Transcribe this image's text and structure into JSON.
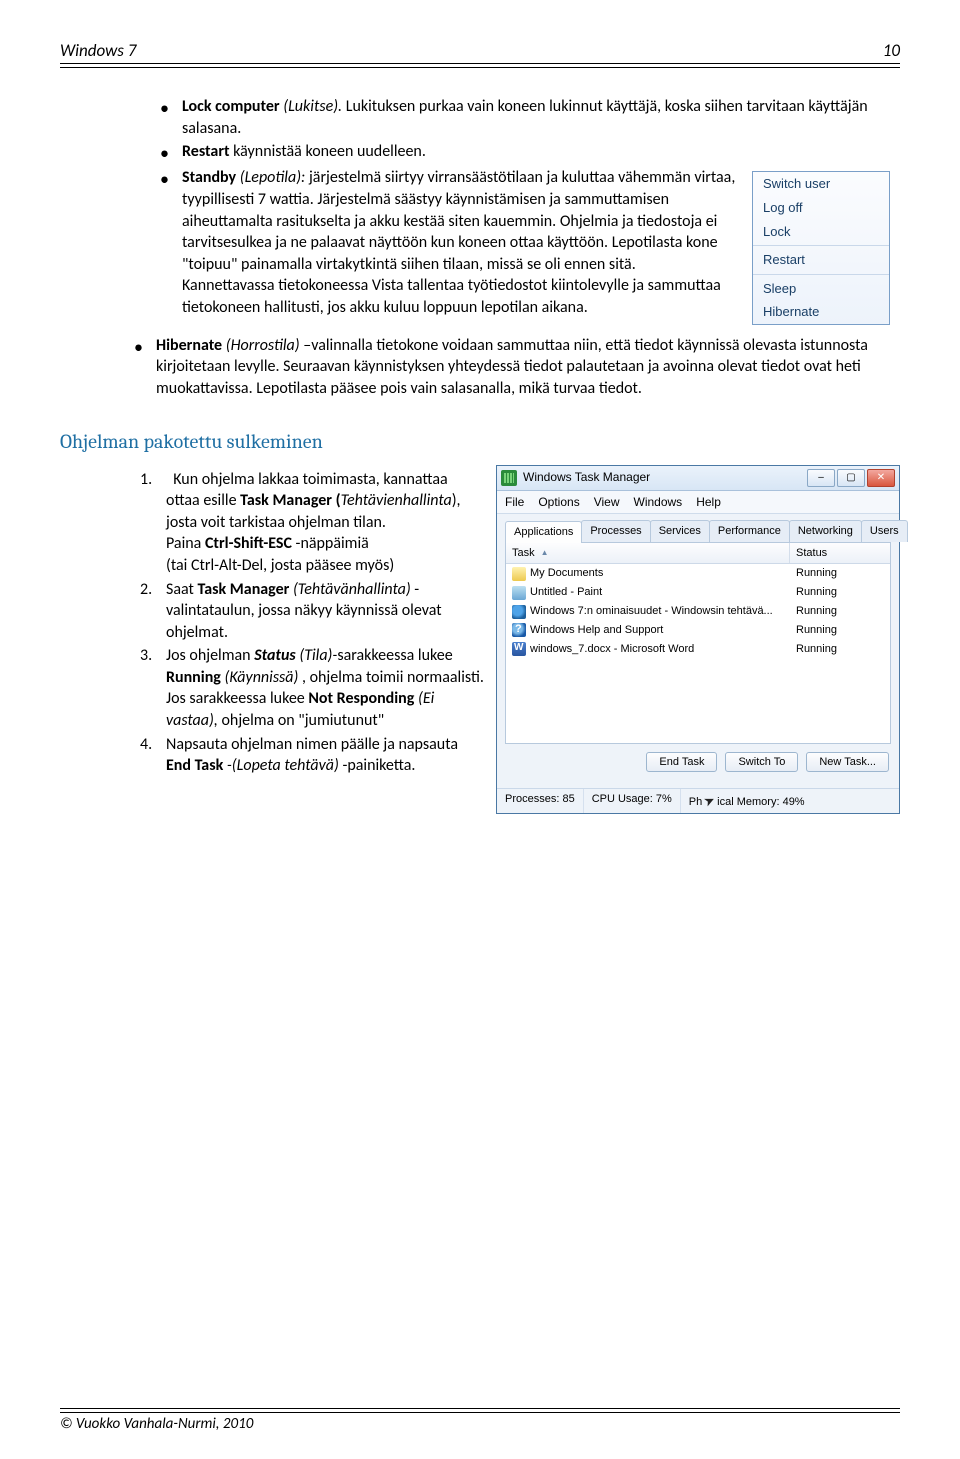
{
  "header": {
    "title": "Windows 7",
    "page_number": "10"
  },
  "bullets": {
    "b1_prefix": "Lock computer",
    "b1_paren": " (Lukitse).",
    "b1_rest": " Lukituksen purkaa vain koneen lukinnut käyttäjä, koska siihen tarvitaan käyttäjän salasana.",
    "b2_prefix": "Restart",
    "b2_rest": " käynnistää koneen uudelleen.",
    "b3_prefix": "Standby",
    "b3_paren": " (Lepotila): ",
    "b3_rest": "järjestelmä siirtyy virransäästötilaan ja kuluttaa vähemmän virtaa, tyypillisesti 7 wattia. Järjestelmä säästyy käynnistämisen ja sammuttamisen aiheuttamalta rasitukselta ja akku kestää siten kauemmin. Ohjelmia ja tiedostoja ei tarvitsesulkea ja ne palaavat näyttöön kun koneen ottaa käyttöön. Lepotilasta kone \"toipuu\" painamalla virtakytkintä siihen tilaan, missä se oli ennen sitä.",
    "b3_cont": "Kannettavassa  tietokoneessa Vista tallentaa työtiedostot kiintolevylle ja sammuttaa tietokoneen hallitusti, jos akku kuluu loppuun lepotilan aikana.",
    "b4_prefix": "Hibernate",
    "b4_paren": " (Horrostila) ",
    "b4_rest": "–valinnalla tietokone voidaan sammuttaa niin, että tiedot käynnissä olevasta istunnosta kirjoitetaan levylle. Seuraavan käynnistyksen yhteydessä tiedot palautetaan ja  avoinna olevat tiedot ovat heti muokattavissa. Lepotilasta pääsee pois vain salasanalla, mikä turvaa tiedot."
  },
  "shutdown_menu": {
    "items": [
      "Switch user",
      "Log off",
      "Lock",
      "Restart",
      "Sleep",
      "Hibernate"
    ]
  },
  "section_heading": "Ohjelman pakotettu sulkeminen",
  "steps": {
    "s1a": "Kun ohjelma  lakkaa toimimasta, kannattaa ottaa esille ",
    "s1b": "Task Manager (",
    "s1c": "Tehtävienhallinta",
    "s1d": "), josta voit tarkistaa ohjelman tilan.",
    "s1e": "Paina ",
    "s1f": "Ctrl-Shift-ESC",
    "s1g": "  -näppäimiä",
    "s1h": "(tai  Ctrl-Alt-Del, josta pääsee myös)",
    "s2a": "Saat ",
    "s2b": "Task Manager ",
    "s2c": "(Tehtävänhallinta)",
    "s2d": " -valintataulun, jossa näkyy käynnissä olevat ohjelmat.",
    "s3a": "Jos ohjelman ",
    "s3b": "Status",
    "s3c": " (Tila)-",
    "s3d": "sarakkeessa lukee ",
    "s3e": "Running",
    "s3f": " (Käynnissä)",
    "s3g": " , ohjelma toimii normaalisti. Jos sarakkeessa lukee ",
    "s3h": "Not Responding ",
    "s3i": "(Ei vastaa), ",
    "s3j": "ohjelma on \"jumiutunut\"",
    "s4a": "Napsauta ohjelman nimen päälle ja napsauta ",
    "s4b": "End Task",
    "s4c": " -(Lopeta tehtävä) ",
    "s4d": "-painiketta."
  },
  "taskmgr": {
    "title": "Windows Task Manager",
    "menu": [
      "File",
      "Options",
      "View",
      "Windows",
      "Help"
    ],
    "tabs": [
      "Applications",
      "Processes",
      "Services",
      "Performance",
      "Networking",
      "Users"
    ],
    "columns": {
      "task": "Task",
      "status": "Status"
    },
    "rows": [
      {
        "icon": "folder",
        "name": "My Documents",
        "status": "Running"
      },
      {
        "icon": "paint",
        "name": "Untitled - Paint",
        "status": "Running"
      },
      {
        "icon": "ie",
        "name": "Windows 7:n ominaisuudet - Windowsin tehtävä...",
        "status": "Running"
      },
      {
        "icon": "help",
        "name": "Windows Help and Support",
        "status": "Running"
      },
      {
        "icon": "word",
        "name": "windows_7.docx - Microsoft Word",
        "status": "Running"
      }
    ],
    "buttons": {
      "end": "End Task",
      "switch": "Switch To",
      "new": "New Task..."
    },
    "status": {
      "proc": "Processes: 85",
      "cpu": "CPU Usage: 7%",
      "mem_a": "Ph",
      "mem_b": "ical Memory: 49%"
    }
  },
  "footer": {
    "text": "© Vuokko Vanhala-Nurmi, 2010"
  }
}
